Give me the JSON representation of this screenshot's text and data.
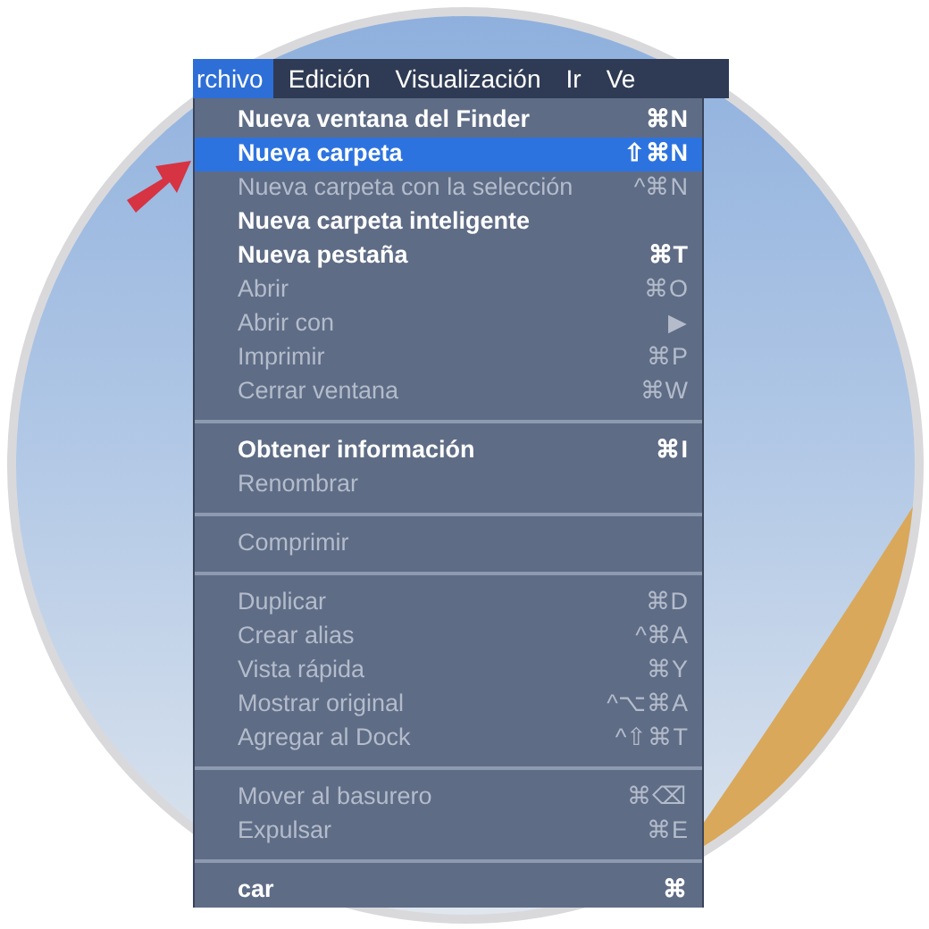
{
  "menu_bar": [
    {
      "label": "rchivo",
      "selected": true
    },
    {
      "label": "Edición",
      "selected": false
    },
    {
      "label": "Visualización",
      "selected": false
    },
    {
      "label": "Ir",
      "selected": false
    },
    {
      "label": "Ve",
      "selected": false
    }
  ],
  "menu": [
    {
      "kind": "item",
      "label": "Nueva ventana del Finder",
      "shortcut": "⌘N",
      "disabled": false,
      "selected": false
    },
    {
      "kind": "item",
      "label": "Nueva carpeta",
      "shortcut": "⇧⌘N",
      "disabled": false,
      "selected": true
    },
    {
      "kind": "item",
      "label": "Nueva carpeta con la selección",
      "shortcut": "^⌘N",
      "disabled": true,
      "selected": false
    },
    {
      "kind": "item",
      "label": "Nueva carpeta inteligente",
      "disabled": false,
      "selected": false
    },
    {
      "kind": "item",
      "label": "Nueva pestaña",
      "shortcut": "⌘T",
      "disabled": false,
      "selected": false
    },
    {
      "kind": "item",
      "label": "Abrir",
      "shortcut": "⌘O",
      "disabled": true,
      "selected": false
    },
    {
      "kind": "item",
      "label": "Abrir con",
      "shortcut": "▶",
      "disabled": true,
      "selected": false
    },
    {
      "kind": "item",
      "label": "Imprimir",
      "shortcut": "⌘P",
      "disabled": true,
      "selected": false
    },
    {
      "kind": "item",
      "label": "Cerrar ventana",
      "shortcut": "⌘W",
      "disabled": true,
      "selected": false
    },
    {
      "kind": "separator"
    },
    {
      "kind": "item",
      "label": "Obtener información",
      "shortcut": "⌘I",
      "disabled": false,
      "selected": false
    },
    {
      "kind": "item",
      "label": "Renombrar",
      "disabled": true,
      "selected": false
    },
    {
      "kind": "separator"
    },
    {
      "kind": "item",
      "label": "Comprimir",
      "disabled": true,
      "selected": false
    },
    {
      "kind": "separator"
    },
    {
      "kind": "item",
      "label": "Duplicar",
      "shortcut": "⌘D",
      "disabled": true,
      "selected": false
    },
    {
      "kind": "item",
      "label": "Crear alias",
      "shortcut": "^⌘A",
      "disabled": true,
      "selected": false
    },
    {
      "kind": "item",
      "label": "Vista rápida",
      "shortcut": "⌘Y",
      "disabled": true,
      "selected": false
    },
    {
      "kind": "item",
      "label": "Mostrar original",
      "shortcut": "^⌥⌘A",
      "disabled": true,
      "selected": false
    },
    {
      "kind": "item",
      "label": "Agregar al Dock",
      "shortcut": "^⇧⌘T",
      "disabled": true,
      "selected": false
    },
    {
      "kind": "separator"
    },
    {
      "kind": "item",
      "label": "Mover al basurero",
      "shortcut": "⌘⌫",
      "disabled": true,
      "selected": false
    },
    {
      "kind": "item",
      "label": "Expulsar",
      "shortcut": "⌘E",
      "disabled": true,
      "selected": false
    },
    {
      "kind": "separator"
    },
    {
      "kind": "item",
      "label": "car",
      "shortcut": "⌘",
      "disabled": false,
      "selected": false
    }
  ]
}
